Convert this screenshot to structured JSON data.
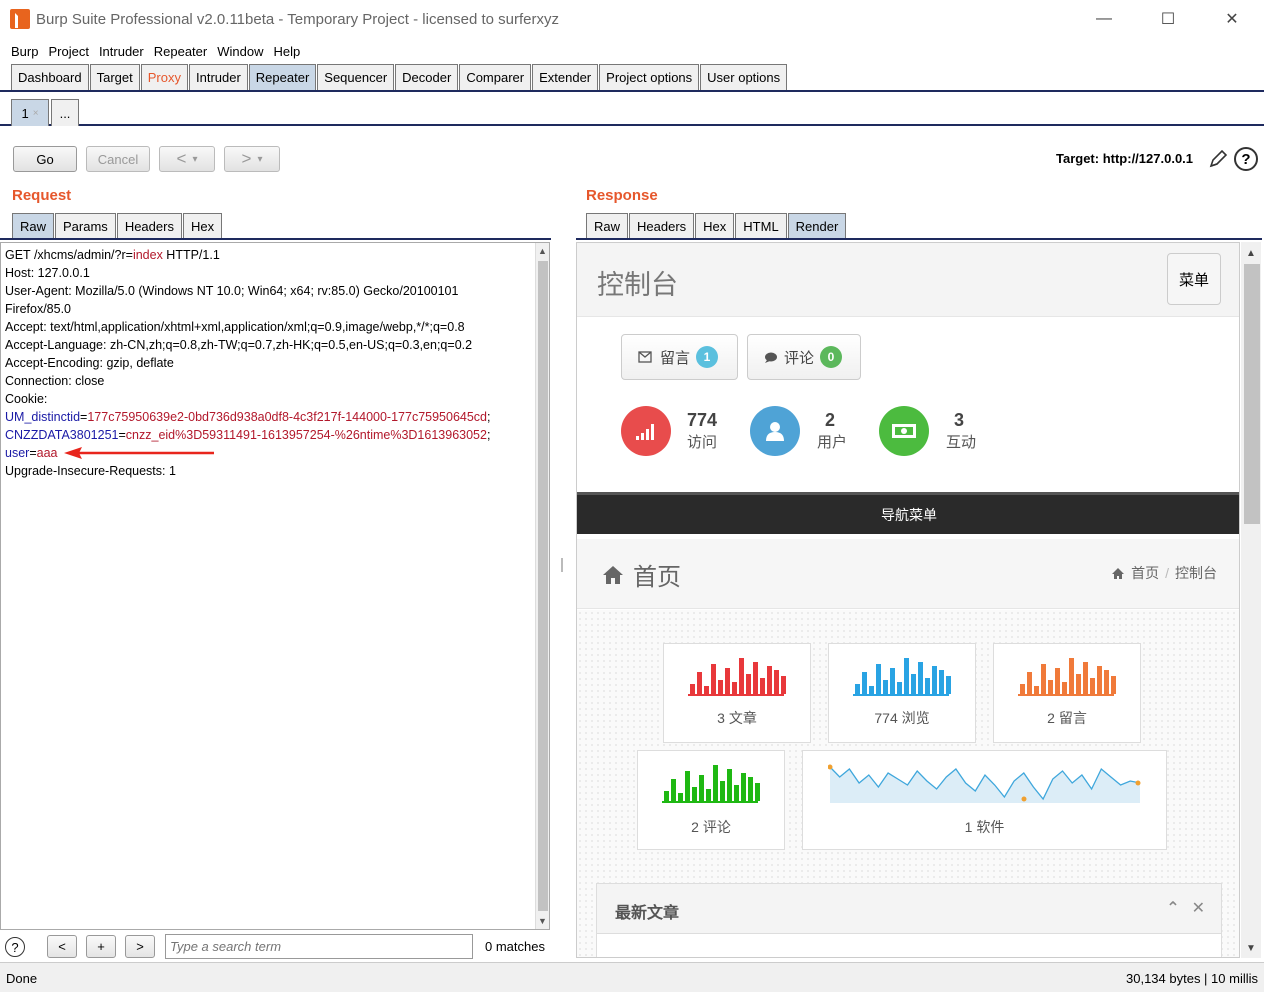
{
  "window": {
    "title": "Burp Suite Professional v2.0.11beta - Temporary Project - licensed to surferxyz",
    "minimize": "—",
    "maximize": "☐",
    "close": "✕"
  },
  "menu": [
    "Burp",
    "Project",
    "Intruder",
    "Repeater",
    "Window",
    "Help"
  ],
  "main_tabs": [
    "Dashboard",
    "Target",
    "Proxy",
    "Intruder",
    "Repeater",
    "Sequencer",
    "Decoder",
    "Comparer",
    "Extender",
    "Project options",
    "User options"
  ],
  "active_main_tab": "Repeater",
  "repeater_tabs": {
    "first": "1",
    "first_close": "×",
    "more": "..."
  },
  "toolbar": {
    "go": "Go",
    "cancel": "Cancel",
    "back": "<",
    "forward": ">",
    "dropdown": "▾",
    "target": "Target: http://127.0.0.1",
    "help": "?"
  },
  "request": {
    "label": "Request",
    "tabs": [
      "Raw",
      "Params",
      "Headers",
      "Hex"
    ],
    "lines": {
      "l1a": "GET /xhcms/admin/?r=",
      "l1b": "index",
      "l1c": " HTTP/1.1",
      "l2": "Host: 127.0.0.1",
      "l3": "User-Agent: Mozilla/5.0 (Windows NT 10.0; Win64; x64; rv:85.0) Gecko/20100101",
      "l4": "Firefox/85.0",
      "l5": "Accept: text/html,application/xhtml+xml,application/xml;q=0.9,image/webp,*/*;q=0.8",
      "l6": "Accept-Language: zh-CN,zh;q=0.8,zh-TW;q=0.7,zh-HK;q=0.5,en-US;q=0.3,en;q=0.2",
      "l7": "Accept-Encoding: gzip, deflate",
      "l8": "Connection: close",
      "l9": "Cookie:",
      "c1n": "UM_distinctid",
      "c1v": "177c75950639e2-0bd736d938a0df8-4c3f217f-144000-177c75950645cd",
      "c2n": "CNZZDATA3801251",
      "c2v": "cnzz_eid%3D59311491-1613957254-%26ntime%3D1613963052",
      "c3n": "user",
      "c3v": "aaa",
      "eq": "=",
      "semi": ";",
      "l10": "Upgrade-Insecure-Requests: 1"
    }
  },
  "search": {
    "help": "?",
    "prev": "<",
    "add": "+",
    "next": ">",
    "placeholder": "Type a search term",
    "matches": "0 matches"
  },
  "response": {
    "label": "Response",
    "tabs": [
      "Raw",
      "Headers",
      "Hex",
      "HTML",
      "Render"
    ],
    "active_tab": "Render"
  },
  "render": {
    "title": "控制台",
    "menu_button": "菜单",
    "pills": [
      {
        "label": "留言",
        "count": "1",
        "color": "#5bc0de"
      },
      {
        "label": "评论",
        "count": "0",
        "color": "#5cb85c"
      }
    ],
    "stats": [
      {
        "num": "774",
        "label": "访问",
        "color": "#e84c4c"
      },
      {
        "num": "2",
        "label": "用户",
        "color": "#4fa3d6"
      },
      {
        "num": "3",
        "label": "互动",
        "color": "#4cbb3f"
      }
    ],
    "nav": "导航菜单",
    "page_heading": "首页",
    "breadcrumb": [
      "首页",
      "控制台"
    ],
    "cards": [
      {
        "label": "3 文章",
        "color": "#e8383b"
      },
      {
        "label": "774 浏览",
        "color": "#29a3e3"
      },
      {
        "label": "2 留言",
        "color": "#f07a3a"
      },
      {
        "label": "2 评论",
        "color": "#1fb813"
      },
      {
        "label": "1 软件",
        "color": "#3fa7dc"
      }
    ],
    "panel_title": "最新文章"
  },
  "status": {
    "left": "Done",
    "right": "30,134 bytes | 10 millis"
  }
}
